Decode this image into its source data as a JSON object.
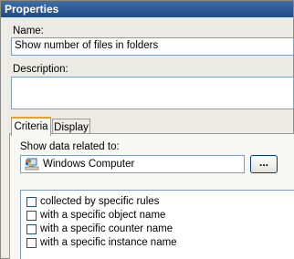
{
  "window": {
    "title": "Properties"
  },
  "name_field": {
    "label": "Name:",
    "value": "Show number of files in folders"
  },
  "description_field": {
    "label": "Description:",
    "value": ""
  },
  "tabs": [
    {
      "label": "Criteria"
    },
    {
      "label": "Display"
    }
  ],
  "criteria": {
    "show_data_label": "Show data related to:",
    "target": {
      "value": "Windows Computer",
      "icon": "computer-icon"
    },
    "browse_label": "...",
    "conditions": [
      {
        "label": "collected by specific rules",
        "checked": false
      },
      {
        "label": "with a specific object name",
        "checked": false
      },
      {
        "label": "with a specific counter name",
        "checked": false
      },
      {
        "label": "with a specific instance name",
        "checked": false
      }
    ]
  }
}
